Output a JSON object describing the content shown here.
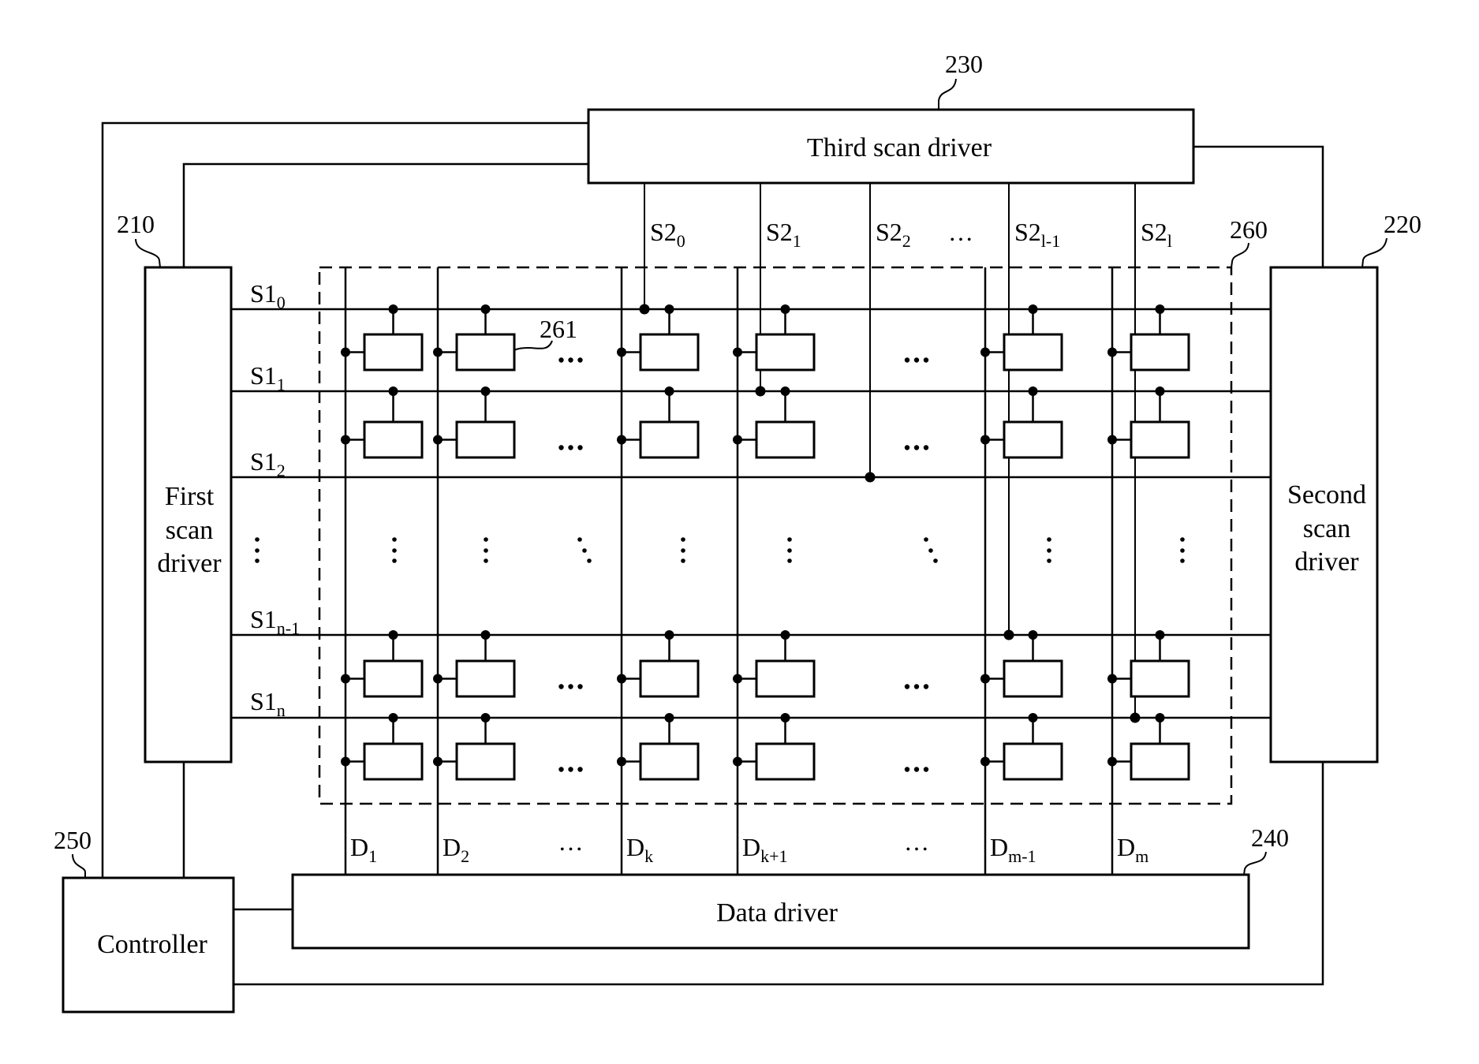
{
  "blocks": {
    "first_scan_driver": {
      "ref": "210",
      "lines": [
        "First",
        "scan",
        "driver"
      ]
    },
    "second_scan_driver": {
      "ref": "220",
      "lines": [
        "Second",
        "scan",
        "driver"
      ]
    },
    "third_scan_driver": {
      "ref": "230",
      "label": "Third scan driver"
    },
    "data_driver": {
      "ref": "240",
      "label": "Data driver"
    },
    "controller": {
      "ref": "250",
      "label": "Controller"
    },
    "pixel_area": {
      "ref": "260"
    },
    "pixel": {
      "ref": "261"
    }
  },
  "first_scan_lines": [
    {
      "base": "S1",
      "sub": "0"
    },
    {
      "base": "S1",
      "sub": "1"
    },
    {
      "base": "S1",
      "sub": "2"
    },
    {
      "base": "S1",
      "sub": "n-1"
    },
    {
      "base": "S1",
      "sub": "n"
    }
  ],
  "second_scan_lines": [
    {
      "base": "S2",
      "sub": "0"
    },
    {
      "base": "S2",
      "sub": "1"
    },
    {
      "base": "S2",
      "sub": "2"
    },
    {
      "base": "S2",
      "sub": "l-1"
    },
    {
      "base": "S2",
      "sub": "l"
    }
  ],
  "data_lines": [
    {
      "base": "D",
      "sub": "1"
    },
    {
      "base": "D",
      "sub": "2"
    },
    {
      "base": "D",
      "sub": "k"
    },
    {
      "base": "D",
      "sub": "k+1"
    },
    {
      "base": "D",
      "sub": "m-1"
    },
    {
      "base": "D",
      "sub": "m"
    }
  ],
  "ellipsis": "…"
}
